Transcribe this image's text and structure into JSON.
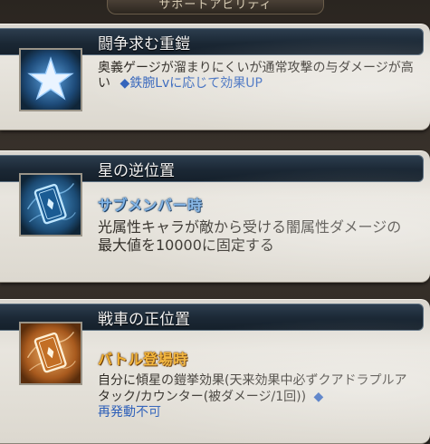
{
  "screen": {
    "banner": "サポートアビリティ"
  },
  "abilities": [
    {
      "name": "闘争求む重鎧",
      "icon": "star-icon",
      "description": "奥義ゲージが溜まりにくいが通常攻撃の与ダメージが高い",
      "hint": "◆鉄腕Lvに応じて効果UP"
    },
    {
      "name": "星の逆位置",
      "icon": "tarot-card-icon",
      "condition": "サブメンバー時",
      "description": "光属性キャラが敵から受ける闇属性ダメージの最大値を10000に固定する"
    },
    {
      "name": "戦車の正位置",
      "icon": "tarot-card-icon",
      "condition": "バトル登場時",
      "description": "自分に傾星の鎧挙効果(天来効果中必ずクアドラプルアタック/カウンター(被ダメージ/1回))",
      "hint": "◆",
      "note": "再発動不可"
    }
  ],
  "colors": {
    "header_bg": "#1b2835",
    "card_bg": "#e2dfd8",
    "blue_icon": "#2f6fb0",
    "orange_icon": "#c8772c",
    "sub_label_blue": "#7eb2e6",
    "sub_label_orange": "#f2b233",
    "hint_blue": "#2a5db8"
  }
}
